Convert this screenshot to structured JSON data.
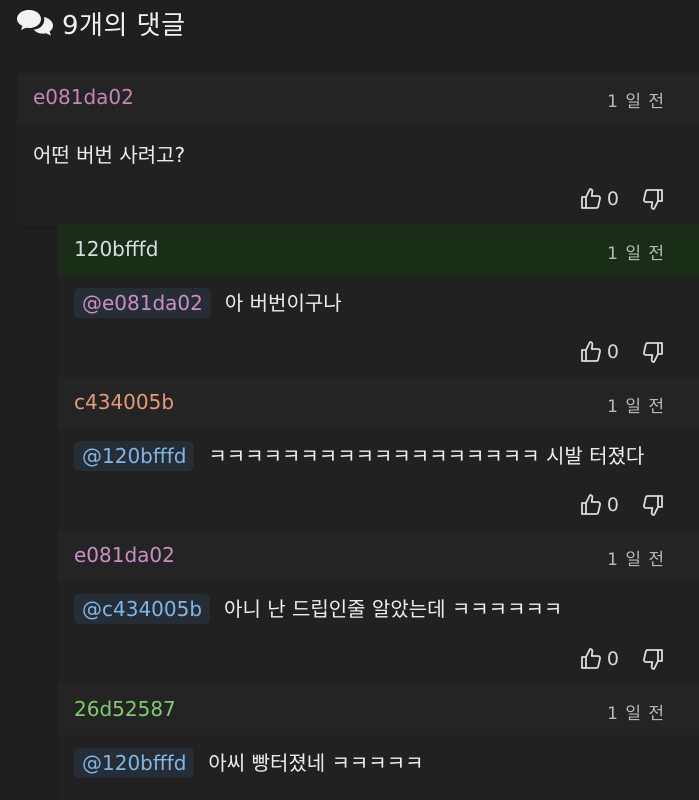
{
  "header": {
    "title": "9개의 댓글",
    "icon": "comments-icon"
  },
  "comments": [
    {
      "author": "e081da02",
      "time": "1 일 전",
      "text": "어떤 버번 사려고?",
      "mention": "",
      "likes": "0"
    },
    {
      "author": "120bfffd",
      "time": "1 일 전",
      "text": "아 버번이구나",
      "mention": "@e081da02",
      "likes": "0"
    },
    {
      "author": "c434005b",
      "time": "1 일 전",
      "text": "ㅋㅋㅋㅋㅋㅋㅋㅋㅋㅋㅋㅋㅋㅋㅋㅋㅋㅋ 시발 터졌다",
      "mention": "@120bfffd",
      "likes": "0"
    },
    {
      "author": "e081da02",
      "time": "1 일 전",
      "text": "아니 난 드립인줄 알았는데 ㅋㅋㅋㅋㅋㅋ",
      "mention": "@c434005b",
      "likes": "0"
    },
    {
      "author": "26d52587",
      "time": "1 일 전",
      "text": "아씨 빵터졌네 ㅋㅋㅋㅋㅋ",
      "mention": "@120bfffd",
      "likes": ""
    }
  ]
}
